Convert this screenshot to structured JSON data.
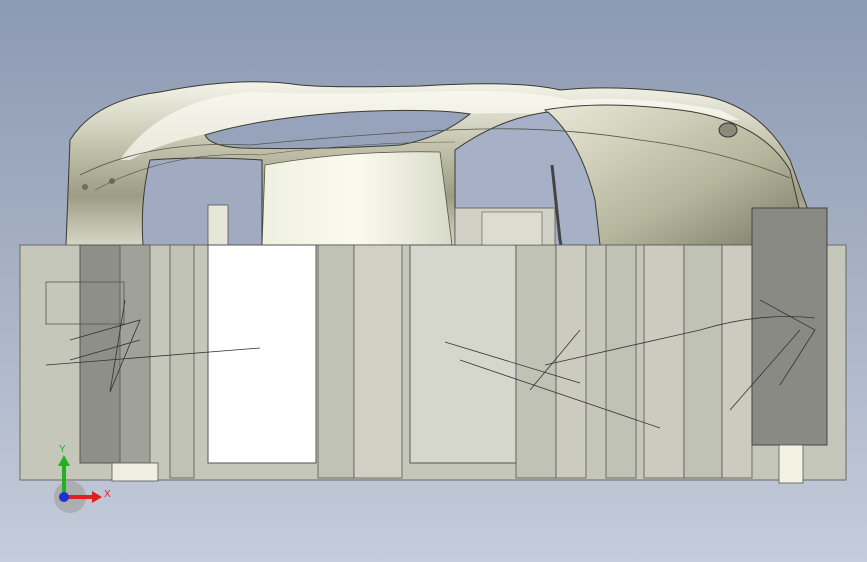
{
  "viewport": {
    "model": "car-body-shell-on-fixture",
    "view": "side-elevation",
    "background_top": "#8c9ab2",
    "background_bottom": "#c5ccdb",
    "body_color": "#d8d9c4",
    "fixture_color": "#c8c9bd",
    "dark_block_color": "#8a8a84"
  },
  "triad": {
    "x_label": "X",
    "y_label": "Y",
    "x_color": "#e02020",
    "y_color": "#20b020",
    "z_color": "#2030d0"
  }
}
